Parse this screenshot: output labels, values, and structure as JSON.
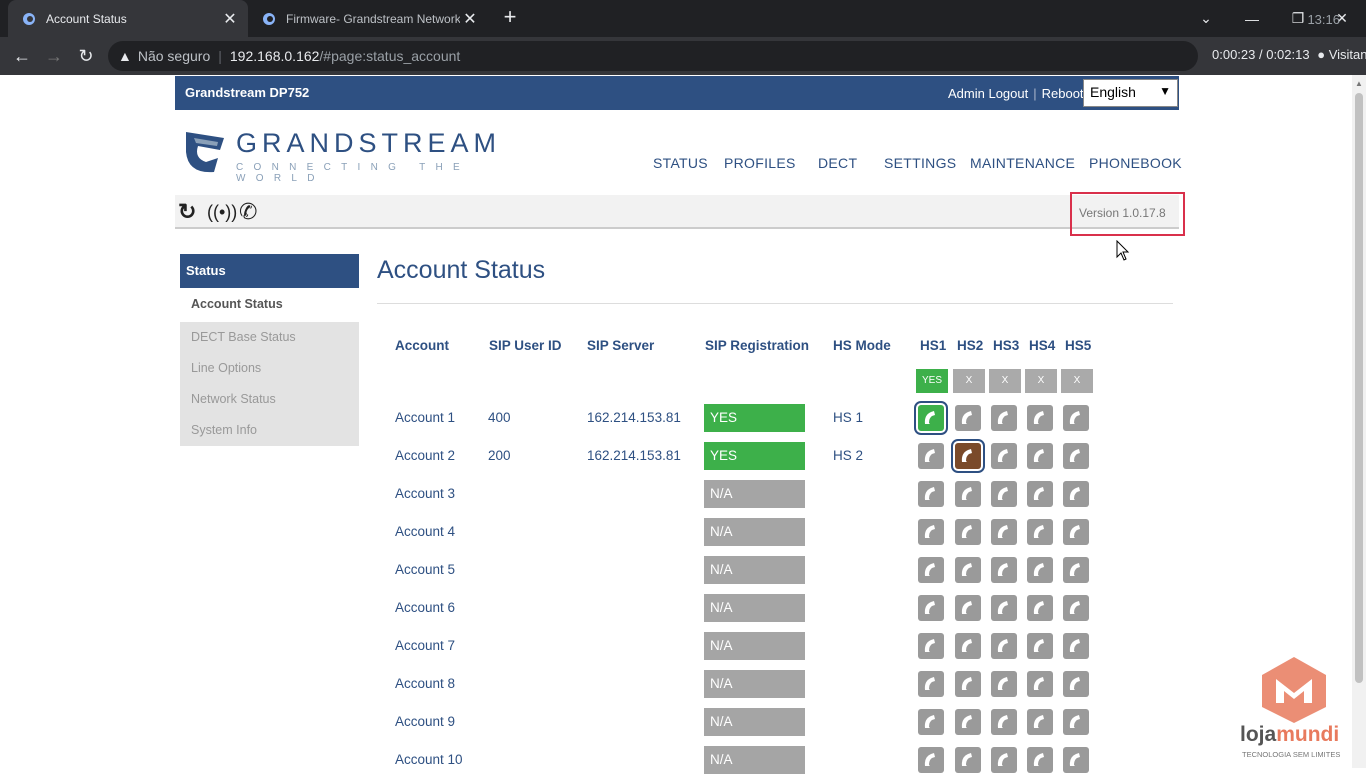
{
  "browser": {
    "tabs": [
      {
        "title": "Account Status",
        "active": true
      },
      {
        "title": "Firmware- Grandstream Network",
        "active": false
      }
    ],
    "clock_top": "13:16",
    "address": {
      "security": "Não seguro",
      "host": "192.168.0.162",
      "path": "/#page:status_account"
    },
    "profile_text": "Visitante",
    "recording_time": "0:00:23 / 0:02:13"
  },
  "header": {
    "brand": "Grandstream DP752",
    "admin_logout": "Admin Logout",
    "reboot": "Reboot",
    "language": "English"
  },
  "logo": {
    "wordmark": "GRANDSTREAM",
    "tagline": "CONNECTING THE WORLD"
  },
  "nav": [
    "STATUS",
    "PROFILES",
    "DECT",
    "SETTINGS",
    "MAINTENANCE",
    "PHONEBOOK"
  ],
  "version": "Version 1.0.17.8",
  "sidebar": {
    "head": "Status",
    "items": [
      {
        "label": "Account Status",
        "active": true
      },
      {
        "label": "DECT Base Status",
        "active": false
      },
      {
        "label": "Line Options",
        "active": false
      },
      {
        "label": "Network Status",
        "active": false
      },
      {
        "label": "System Info",
        "active": false
      }
    ]
  },
  "page_title": "Account Status",
  "table": {
    "headers": [
      "Account",
      "SIP User ID",
      "SIP Server",
      "SIP Registration",
      "HS Mode",
      "HS1",
      "HS2",
      "HS3",
      "HS4",
      "HS5"
    ],
    "hs_status": [
      "YES",
      "X",
      "X",
      "X",
      "X"
    ],
    "rows": [
      {
        "account": "Account 1",
        "sip_user_id": "400",
        "sip_server": "162.214.153.81",
        "registration": "YES",
        "hs_mode": "HS 1",
        "selected_hs": 1,
        "color": "green"
      },
      {
        "account": "Account 2",
        "sip_user_id": "200",
        "sip_server": "162.214.153.81",
        "registration": "YES",
        "hs_mode": "HS 2",
        "selected_hs": 2,
        "color": "brown"
      },
      {
        "account": "Account 3",
        "sip_user_id": "",
        "sip_server": "",
        "registration": "N/A",
        "hs_mode": "",
        "selected_hs": 0,
        "color": ""
      },
      {
        "account": "Account 4",
        "sip_user_id": "",
        "sip_server": "",
        "registration": "N/A",
        "hs_mode": "",
        "selected_hs": 0,
        "color": ""
      },
      {
        "account": "Account 5",
        "sip_user_id": "",
        "sip_server": "",
        "registration": "N/A",
        "hs_mode": "",
        "selected_hs": 0,
        "color": ""
      },
      {
        "account": "Account 6",
        "sip_user_id": "",
        "sip_server": "",
        "registration": "N/A",
        "hs_mode": "",
        "selected_hs": 0,
        "color": ""
      },
      {
        "account": "Account 7",
        "sip_user_id": "",
        "sip_server": "",
        "registration": "N/A",
        "hs_mode": "",
        "selected_hs": 0,
        "color": ""
      },
      {
        "account": "Account 8",
        "sip_user_id": "",
        "sip_server": "",
        "registration": "N/A",
        "hs_mode": "",
        "selected_hs": 0,
        "color": ""
      },
      {
        "account": "Account 9",
        "sip_user_id": "",
        "sip_server": "",
        "registration": "N/A",
        "hs_mode": "",
        "selected_hs": 0,
        "color": ""
      },
      {
        "account": "Account 10",
        "sip_user_id": "",
        "sip_server": "",
        "registration": "N/A",
        "hs_mode": "",
        "selected_hs": 0,
        "color": ""
      }
    ]
  },
  "watermark": {
    "name_a": "loja",
    "name_b": "mundi",
    "tagline": "TECNOLOGIA SEM LIMITES"
  },
  "colors": {
    "brand_blue": "#2e5082",
    "registered_green": "#3db04a",
    "na_gray": "#a5a5a5",
    "highlight_red": "#d9304b"
  }
}
